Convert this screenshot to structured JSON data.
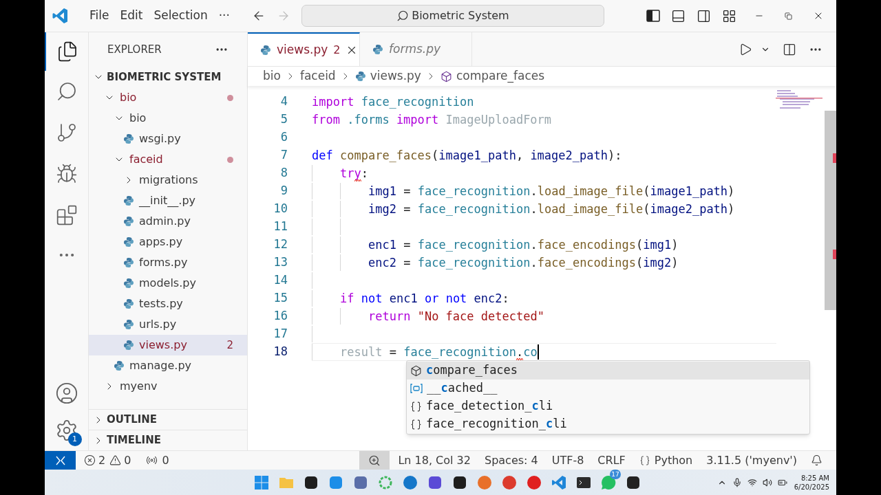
{
  "title_bar": {
    "menu": [
      "File",
      "Edit",
      "Selection",
      "···"
    ],
    "search": "Biometric System"
  },
  "explorer": {
    "title": "EXPLORER",
    "root": "BIOMETRIC SYSTEM",
    "tree": [
      {
        "label": "bio",
        "kind": "folder",
        "expanded": true,
        "problem": true,
        "selected": false,
        "children": [
          {
            "label": "bio",
            "kind": "folder",
            "expanded": true,
            "problem": false,
            "selected": false,
            "children": [
              {
                "label": "wsgi.py",
                "kind": "file",
                "problem": false,
                "selected": false
              }
            ]
          },
          {
            "label": "faceid",
            "kind": "folder",
            "expanded": true,
            "problem": true,
            "selected": false,
            "children": [
              {
                "label": "migrations",
                "kind": "folder",
                "expanded": false,
                "problem": false,
                "selected": false
              },
              {
                "label": "__init__.py",
                "kind": "file",
                "problem": false,
                "selected": false
              },
              {
                "label": "admin.py",
                "kind": "file",
                "problem": false,
                "selected": false
              },
              {
                "label": "apps.py",
                "kind": "file",
                "problem": false,
                "selected": false
              },
              {
                "label": "forms.py",
                "kind": "file",
                "problem": false,
                "selected": false
              },
              {
                "label": "models.py",
                "kind": "file",
                "problem": false,
                "selected": false
              },
              {
                "label": "tests.py",
                "kind": "file",
                "problem": false,
                "selected": false
              },
              {
                "label": "urls.py",
                "kind": "file",
                "problem": false,
                "selected": false
              },
              {
                "label": "views.py",
                "kind": "file",
                "problem": true,
                "badge": "2",
                "selected": true
              }
            ]
          },
          {
            "label": "manage.py",
            "kind": "file",
            "problem": false,
            "selected": false
          }
        ]
      },
      {
        "label": "myenv",
        "kind": "folder",
        "expanded": false,
        "problem": false,
        "selected": false
      }
    ],
    "sections": [
      "OUTLINE",
      "TIMELINE"
    ]
  },
  "settings_badge": "1",
  "tabs": [
    {
      "label": "views.py",
      "badge": "2",
      "selected": true,
      "preview": false
    },
    {
      "label": "forms.py",
      "selected": false,
      "preview": true
    }
  ],
  "breadcrumbs": [
    {
      "kind": "folder",
      "label": "bio"
    },
    {
      "kind": "folder",
      "label": "faceid"
    },
    {
      "kind": "file",
      "label": "views.py"
    },
    {
      "kind": "symbol",
      "label": "compare_faces"
    }
  ],
  "code": [
    {
      "n": "4",
      "current": false,
      "tokens": [
        {
          "kind": "keyword",
          "t": "import"
        },
        {
          "kind": "module",
          "t": "face_recognition",
          "space": true
        }
      ]
    },
    {
      "n": "5",
      "current": false,
      "tokens": [
        {
          "kind": "keyword",
          "t": "from"
        },
        {
          "kind": "module",
          "t": ".forms",
          "space": true
        },
        {
          "kind": "keyword",
          "t": "import",
          "space": true
        },
        {
          "kind": "unused",
          "t": "ImageUploadForm",
          "space": true
        }
      ]
    },
    {
      "n": "6",
      "current": false
    },
    {
      "n": "7",
      "current": false,
      "tokens": [
        {
          "kind": "storage",
          "t": "def"
        },
        {
          "kind": "function",
          "t": "compare_faces",
          "space": true
        },
        {
          "kind": "plain",
          "t": "("
        },
        {
          "kind": "variable",
          "t": "image1_path"
        },
        {
          "kind": "plain",
          "t": ","
        },
        {
          "kind": "variable",
          "t": "image2_path",
          "space": true
        },
        {
          "kind": "plain",
          "t": "):"
        }
      ],
      "children": [
        {
          "n": "8",
          "current": false,
          "tokens": [
            {
              "kind": "keyword",
              "t": "try",
              "squiggle": true
            },
            {
              "kind": "plain",
              "t": ":"
            }
          ],
          "children": [
            {
              "n": "9",
              "current": false,
              "tokens": [
                {
                  "kind": "variable",
                  "t": "img1"
                },
                {
                  "kind": "plain",
                  "t": "=",
                  "space": true
                },
                {
                  "kind": "module",
                  "t": "face_recognition",
                  "space": true
                },
                {
                  "kind": "plain",
                  "t": "."
                },
                {
                  "kind": "function",
                  "t": "load_image_file"
                },
                {
                  "kind": "plain",
                  "t": "("
                },
                {
                  "kind": "variable",
                  "t": "image1_path"
                },
                {
                  "kind": "plain",
                  "t": ")"
                }
              ]
            },
            {
              "n": "10",
              "current": false,
              "tokens": [
                {
                  "kind": "variable",
                  "t": "img2"
                },
                {
                  "kind": "plain",
                  "t": "=",
                  "space": true
                },
                {
                  "kind": "module",
                  "t": "face_recognition",
                  "space": true
                },
                {
                  "kind": "plain",
                  "t": "."
                },
                {
                  "kind": "function",
                  "t": "load_image_file"
                },
                {
                  "kind": "plain",
                  "t": "("
                },
                {
                  "kind": "variable",
                  "t": "image2_path"
                },
                {
                  "kind": "plain",
                  "t": ")"
                }
              ]
            },
            {
              "n": "11",
              "current": false
            },
            {
              "n": "12",
              "current": false,
              "tokens": [
                {
                  "kind": "variable",
                  "t": "enc1"
                },
                {
                  "kind": "plain",
                  "t": "=",
                  "space": true
                },
                {
                  "kind": "module",
                  "t": "face_recognition",
                  "space": true
                },
                {
                  "kind": "plain",
                  "t": "."
                },
                {
                  "kind": "function",
                  "t": "face_encodings"
                },
                {
                  "kind": "plain",
                  "t": "("
                },
                {
                  "kind": "variable",
                  "t": "img1"
                },
                {
                  "kind": "plain",
                  "t": ")"
                }
              ]
            },
            {
              "n": "13",
              "current": false,
              "tokens": [
                {
                  "kind": "variable",
                  "t": "enc2"
                },
                {
                  "kind": "plain",
                  "t": "=",
                  "space": true
                },
                {
                  "kind": "module",
                  "t": "face_recognition",
                  "space": true
                },
                {
                  "kind": "plain",
                  "t": "."
                },
                {
                  "kind": "function",
                  "t": "face_encodings"
                },
                {
                  "kind": "plain",
                  "t": "("
                },
                {
                  "kind": "variable",
                  "t": "img2"
                },
                {
                  "kind": "plain",
                  "t": ")"
                }
              ]
            }
          ]
        },
        {
          "n": "14",
          "current": false
        },
        {
          "n": "15",
          "current": false,
          "tokens": [
            {
              "kind": "keyword",
              "t": "if"
            },
            {
              "kind": "storage",
              "t": "not",
              "space": true
            },
            {
              "kind": "variable",
              "t": "enc1",
              "space": true
            },
            {
              "kind": "storage",
              "t": "or",
              "space": true
            },
            {
              "kind": "storage",
              "t": "not",
              "space": true
            },
            {
              "kind": "variable",
              "t": "enc2",
              "space": true
            },
            {
              "kind": "plain",
              "t": ":"
            }
          ],
          "children": [
            {
              "n": "16",
              "current": false,
              "tokens": [
                {
                  "kind": "keyword",
                  "t": "return"
                },
                {
                  "kind": "string",
                  "t": "\"No face detected\"",
                  "space": true
                }
              ]
            }
          ]
        },
        {
          "n": "17",
          "current": false
        },
        {
          "n": "18",
          "current": true,
          "tokens": [
            {
              "kind": "unused",
              "t": "result"
            },
            {
              "kind": "plain",
              "t": "=",
              "space": true
            },
            {
              "kind": "module",
              "t": "face_recognition",
              "space": true
            },
            {
              "kind": "plain",
              "t": ".",
              "squiggle": true
            },
            {
              "kind": "module",
              "t": "co"
            }
          ]
        }
      ]
    }
  ],
  "completions": [
    {
      "kind": "method",
      "label": "**c**ompare_faces",
      "selected": true
    },
    {
      "kind": "field",
      "label": "__**c**ached__",
      "selected": false
    },
    {
      "kind": "module",
      "label": "face_detection_**c**li",
      "selected": false
    },
    {
      "kind": "module",
      "label": "face_recognition_**c**li",
      "selected": false
    }
  ],
  "status_bar": {
    "errors": "2",
    "warnings": "0",
    "ports": "0",
    "position": "Ln 18, Col 32",
    "spaces": "Spaces: 4",
    "encoding": "UTF-8",
    "eol": "CRLF",
    "language": "Python",
    "interpreter": "3.11.5 ('myenv')"
  },
  "taskbar": {
    "whatsapp_badge": "17",
    "time": "8:25 AM",
    "date": "6/20/2025"
  }
}
